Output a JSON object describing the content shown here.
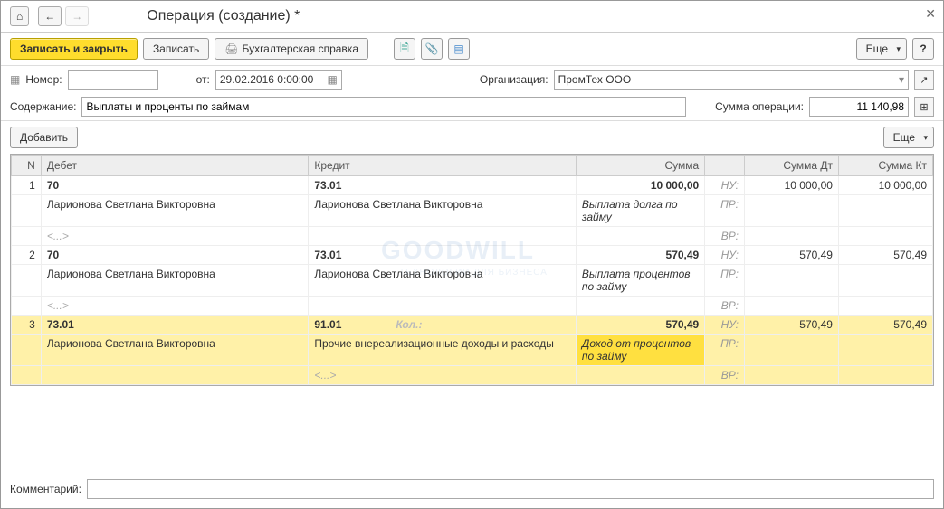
{
  "title": "Операция (создание) *",
  "toolbar": {
    "save_close": "Записать и закрыть",
    "save": "Записать",
    "print_ref": "Бухгалтерская справка",
    "more": "Еще"
  },
  "form": {
    "number_label": "Номер:",
    "from_label": "от:",
    "date_value": "29.02.2016 0:00:00",
    "org_label": "Организация:",
    "org_value": "ПромТех ООО",
    "content_label": "Содержание:",
    "content_value": "Выплаты и проценты по займам",
    "sum_label": "Сумма операции:",
    "sum_value": "11 140,98"
  },
  "table_toolbar": {
    "add": "Добавить",
    "more": "Еще"
  },
  "columns": {
    "n": "N",
    "debit": "Дебет",
    "credit": "Кредит",
    "sum": "Сумма",
    "sum_dt": "Сумма Дт",
    "sum_kt": "Сумма Кт"
  },
  "tags": {
    "nu": "НУ:",
    "pr": "ПР:",
    "vr": "ВР:"
  },
  "rows": [
    {
      "n": "1",
      "debit": "70",
      "credit": "73.01",
      "sum": "10 000,00",
      "sum_dt": "10 000,00",
      "sum_kt": "10 000,00",
      "debit_sub": "Ларионова Светлана Викторовна",
      "credit_sub": "Ларионова Светлана Викторовна",
      "sum_sub": "Выплата долга по займу",
      "debit_sub2": "<...>"
    },
    {
      "n": "2",
      "debit": "70",
      "credit": "73.01",
      "sum": "570,49",
      "sum_dt": "570,49",
      "sum_kt": "570,49",
      "debit_sub": "Ларионова Светлана Викторовна",
      "credit_sub": "Ларионова Светлана Викторовна",
      "sum_sub": "Выплата процентов по займу",
      "debit_sub2": "<...>"
    },
    {
      "n": "3",
      "debit": "73.01",
      "credit": "91.01",
      "credit_kol": "Кол.:",
      "sum": "570,49",
      "sum_dt": "570,49",
      "sum_kt": "570,49",
      "debit_sub": "Ларионова Светлана Викторовна",
      "credit_sub": "Прочие внереализационные доходы и расходы",
      "sum_sub": "Доход от процентов по займу",
      "credit_sub2": "<...>",
      "selected": true
    }
  ],
  "comment_label": "Комментарий:",
  "watermark": "GOODWILL",
  "watermark_sub": "ТЕХНОЛОГИИ ДЛЯ БИЗНЕСА"
}
